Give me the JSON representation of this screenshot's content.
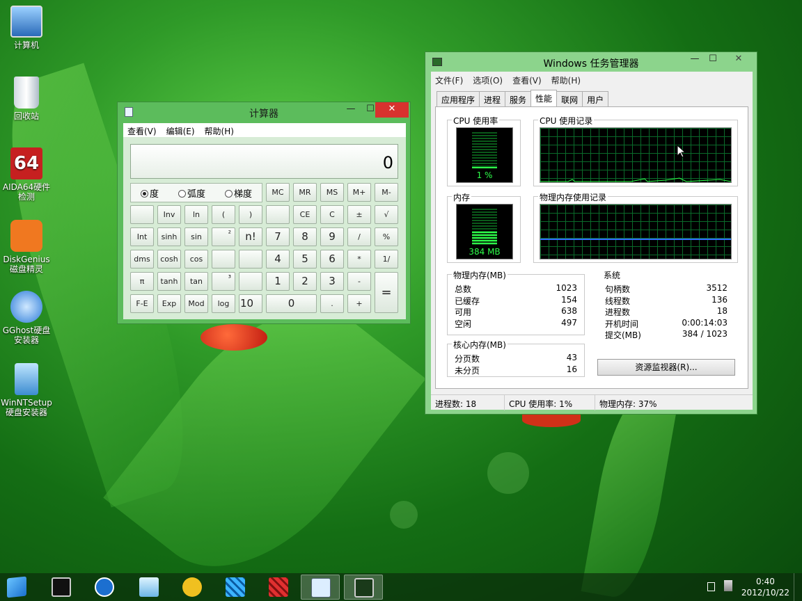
{
  "desktop": {
    "icons": [
      {
        "label": "计算机"
      },
      {
        "label": "回收站"
      },
      {
        "label": "AIDA64硬件\n检测"
      },
      {
        "label": "DiskGenius\n磁盘精灵"
      },
      {
        "label": "GGhost硬盘\n安装器"
      },
      {
        "label": "WinNTSetup\n硬盘安装器"
      }
    ]
  },
  "calc": {
    "title": "计算器",
    "menu": [
      "查看(V)",
      "编辑(E)",
      "帮助(H)"
    ],
    "display": "0",
    "radios": [
      "度",
      "弧度",
      "梯度"
    ],
    "keys": {
      "mc": "MC",
      "mr": "MR",
      "ms": "MS",
      "mplus": "M+",
      "mminus": "M-",
      "inv": "Inv",
      "ln": "ln",
      "lp": "(",
      "rp": ")",
      "back": "",
      "ce": "CE",
      "c": "C",
      "pm": "±",
      "sqrt": "√",
      "int": "Int",
      "sinh": "sinh",
      "sin": "sin",
      "sq": "²",
      "fact": "n!",
      "n7": "7",
      "n8": "8",
      "n9": "9",
      "div": "/",
      "pct": "%",
      "dms": "dms",
      "cosh": "cosh",
      "cos": "cos",
      "pow": "",
      "root": "",
      "n4": "4",
      "n5": "5",
      "n6": "6",
      "mul": "*",
      "recip": "1/",
      "pi": "π",
      "tanh": "tanh",
      "tan": "tan",
      "cube": "³",
      "croot": "",
      "n1": "1",
      "n2": "2",
      "n3": "3",
      "sub": "-",
      "eq": "=",
      "fe": "F-E",
      "exp": "Exp",
      "mod": "Mod",
      "log": "log",
      "ten": "10",
      "n0": "0",
      "dot": ".",
      "add": "+"
    }
  },
  "taskmgr": {
    "title": "Windows 任务管理器",
    "menu": [
      "文件(F)",
      "选项(O)",
      "查看(V)",
      "帮助(H)"
    ],
    "tabs": [
      "应用程序",
      "进程",
      "服务",
      "性能",
      "联网",
      "用户"
    ],
    "cpu_usage_label": "CPU 使用率",
    "cpu_usage_value": "1 %",
    "cpu_history_label": "CPU 使用记录",
    "mem_label": "内存",
    "mem_value": "384 MB",
    "mem_history_label": "物理内存使用记录",
    "phys_title": "物理内存(MB)",
    "phys": [
      [
        "总数",
        "1023"
      ],
      [
        "已缓存",
        "154"
      ],
      [
        "可用",
        "638"
      ],
      [
        "空闲",
        "497"
      ]
    ],
    "kernel_title": "核心内存(MB)",
    "kernel": [
      [
        "分页数",
        "43"
      ],
      [
        "未分页",
        "16"
      ]
    ],
    "sys_title": "系统",
    "sys": [
      [
        "句柄数",
        "3512"
      ],
      [
        "线程数",
        "136"
      ],
      [
        "进程数",
        "18"
      ],
      [
        "开机时间",
        "0:00:14:03"
      ],
      [
        "提交(MB)",
        "384 / 1023"
      ]
    ],
    "resmon": "资源监视器(R)...",
    "status": [
      "进程数: 18",
      "CPU 使用率: 1%",
      "物理内存: 37%"
    ],
    "cpu_percent": 1,
    "mem_percent": 37
  },
  "clock": {
    "time": "0:40",
    "date": "2012/10/22"
  }
}
